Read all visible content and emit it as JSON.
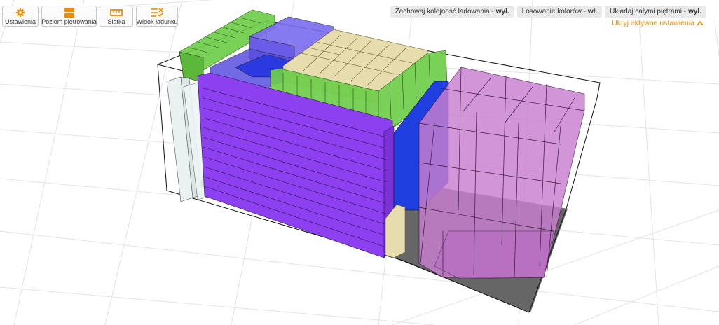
{
  "toolbar": {
    "settings_label": "Ustawienia",
    "stacking_label": "Poziom piętrowania",
    "grid_label": "Siatka",
    "load_view_label": "Widok ładunku",
    "accent_color": "#f08c00"
  },
  "options": {
    "keep_order_label": "Zachowaj kolejność ładowania",
    "keep_order_value": "wył.",
    "random_colors_label": "Losowanie kolorów",
    "random_colors_value": "wł.",
    "full_floors_label": "Układaj całymi piętrami",
    "full_floors_value": "wył.",
    "hide_settings_link": "Ukryj aktywne ustawienia"
  },
  "cargo_colors": {
    "violet": "#8d40f0",
    "blue": "#1f3fe0",
    "light_blue": "#7a6cf0",
    "green": "#6fce4a",
    "beige": "#e6dcae",
    "pink": "#c97fd0",
    "light_gray": "#e9f1f1",
    "floor": "#666666"
  }
}
